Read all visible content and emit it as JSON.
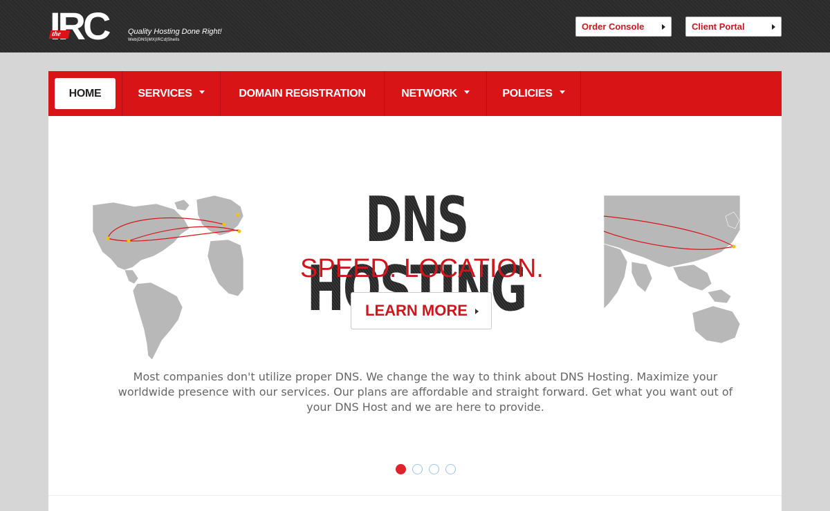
{
  "brand": {
    "logo_word": "IRC",
    "logo_prefix": "the",
    "tagline": "Quality Hosting Done Right!",
    "subline": "Web|DNS|MX|IRCd|Shells"
  },
  "topbar": {
    "order_console": "Order Console",
    "client_portal": "Client Portal"
  },
  "nav": {
    "home": "HOME",
    "services": "SERVICES",
    "domain_registration": "DOMAIN REGISTRATION",
    "network": "NETWORK",
    "policies": "POLICIES"
  },
  "hero": {
    "title": "DNS HOSTING",
    "subtitle": "SPEED. LOCATION.",
    "button": "LEARN MORE",
    "text": "Most companies don't utilize proper DNS. We change the way to think about DNS Hosting. Maximize your worldwide presence with our services. Our plans are affordable and straight forward. Get what you want out of your DNS Host and we are here to provide.",
    "slides_total": 4,
    "active_slide": 1
  },
  "colors": {
    "brand_red": "#d91417",
    "topbar_bg": "#2b2b2b",
    "page_bg": "#d6d6d6",
    "map_land": "#b8b8b8",
    "route_line": "#d81418",
    "route_node": "#f5c400"
  }
}
